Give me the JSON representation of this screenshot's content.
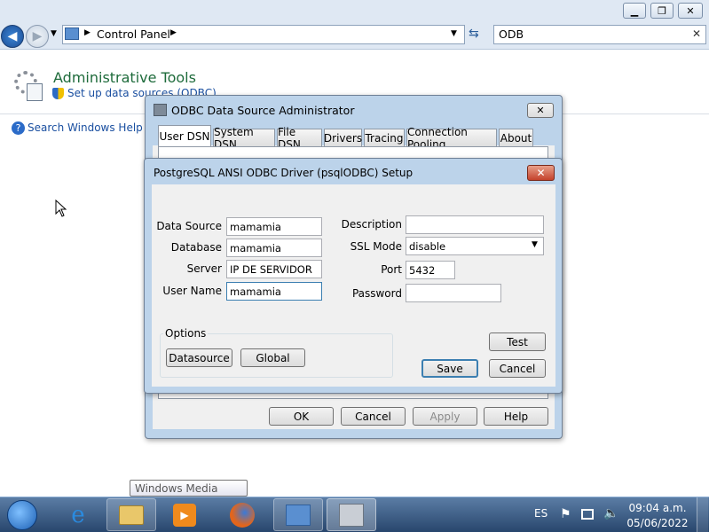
{
  "window": {
    "controls": [
      "minimize",
      "restore",
      "close"
    ]
  },
  "navbar": {
    "breadcrumb_root": "Control Panel",
    "search_value": "ODB"
  },
  "content": {
    "heading": "Administrative Tools",
    "sublink": "Set up data sources (ODBC)",
    "help_link": "Search Windows Help an"
  },
  "odbc": {
    "title": "ODBC Data Source Administrator",
    "tabs": [
      "User DSN",
      "System DSN",
      "File DSN",
      "Drivers",
      "Tracing",
      "Connection Pooling",
      "About"
    ],
    "buttons": {
      "ok": "OK",
      "cancel": "Cancel",
      "apply": "Apply",
      "help": "Help"
    }
  },
  "setup": {
    "title": "PostgreSQL ANSI ODBC Driver (psqlODBC) Setup",
    "labels": {
      "data_source": "Data Source",
      "database": "Database",
      "server": "Server",
      "user_name": "User Name",
      "description": "Description",
      "ssl_mode": "SSL Mode",
      "port": "Port",
      "password": "Password",
      "options": "Options"
    },
    "values": {
      "data_source": "mamamia",
      "database": "mamamia",
      "server": "IP DE SERVIDOR",
      "user_name": "mamamia",
      "description": "",
      "ssl_mode": "disable",
      "port": "5432",
      "password": ""
    },
    "buttons": {
      "datasource": "Datasource",
      "global": "Global",
      "test": "Test",
      "save": "Save",
      "cancel": "Cancel"
    }
  },
  "tooltip": "Windows Media Player",
  "taskbar": {
    "language": "ES",
    "time": "09:04 a.m.",
    "date": "05/06/2022"
  }
}
